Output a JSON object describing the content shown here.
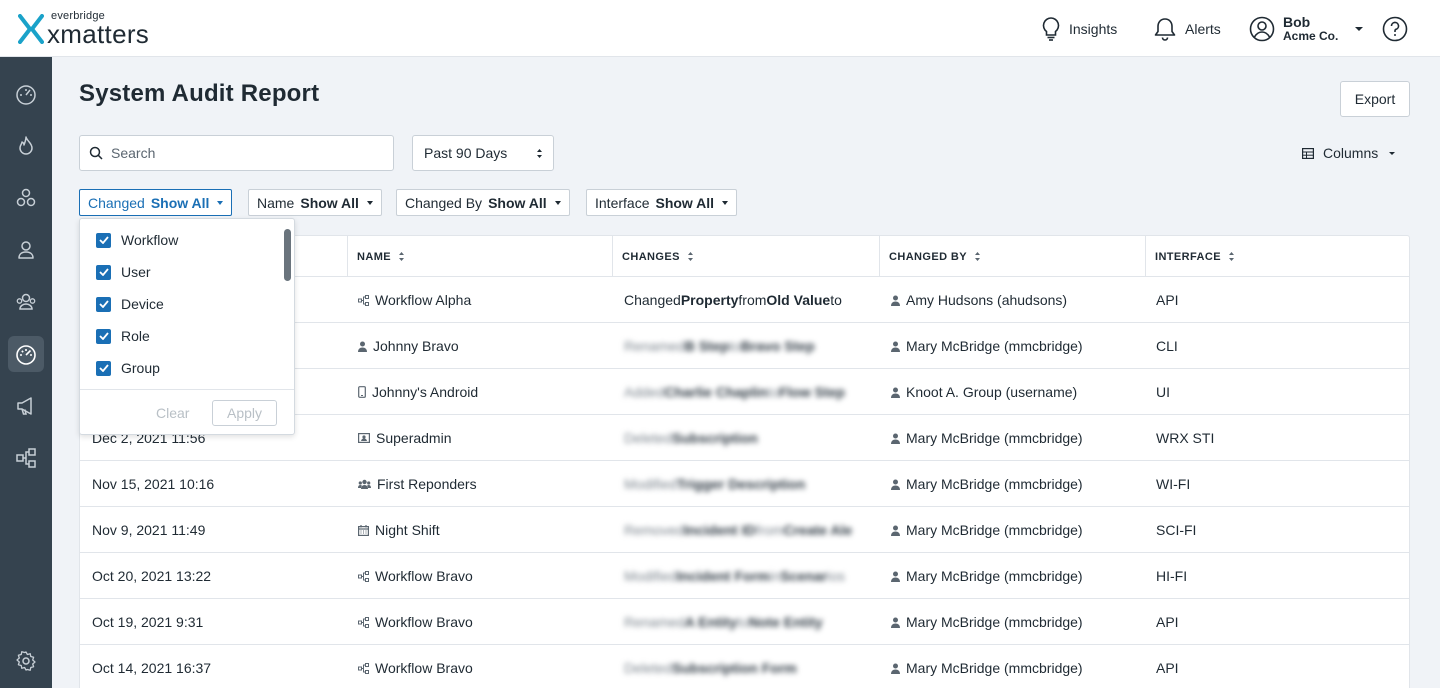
{
  "brand": {
    "small": "everbridge",
    "big": "xmatters"
  },
  "topbar": {
    "insights": "Insights",
    "alerts": "Alerts",
    "user_name": "Bob",
    "user_org": "Acme Co."
  },
  "page": {
    "title": "System Audit Report",
    "export_label": "Export",
    "search_placeholder": "Search",
    "range_value": "Past 90 Days",
    "columns_label": "Columns"
  },
  "filters": [
    {
      "label": "Changed",
      "value": "Show All"
    },
    {
      "label": "Name",
      "value": "Show All"
    },
    {
      "label": "Changed By",
      "value": "Show All"
    },
    {
      "label": "Interface",
      "value": "Show All"
    }
  ],
  "dropdown": {
    "items": [
      "Workflow",
      "User",
      "Device",
      "Role",
      "Group"
    ],
    "clear": "Clear",
    "apply": "Apply"
  },
  "table": {
    "headers": [
      "NAME",
      "CHANGES",
      "CHANGED BY",
      "INTERFACE"
    ],
    "rows": [
      {
        "date": "",
        "name": "Workflow Alpha",
        "name_icon": "workflow-icon",
        "change": {
          "a": "Changed ",
          "b": "Property",
          "c": " from ",
          "d": "Old Value",
          "e": " to"
        },
        "by": "Amy Hudsons (ahudsons)",
        "interface": "API"
      },
      {
        "date": "",
        "name": "Johnny Bravo",
        "name_icon": "user-icon",
        "change": {
          "a": "Renamed ",
          "b": "B Step",
          "c": " to ",
          "d": "Bravo Step",
          "e": ""
        },
        "by": "Mary McBridge (mmcbridge)",
        "interface": "CLI"
      },
      {
        "date": "",
        "name": "Johnny's Android",
        "name_icon": "mobile-icon",
        "change": {
          "a": "Added ",
          "b": "Charlie Chaplin",
          "c": " to ",
          "d": "Flow Step",
          "e": ""
        },
        "by": "Knoot A. Group (username)",
        "interface": "UI"
      },
      {
        "date": "Dec 2, 2021 11:56",
        "name": "Superadmin",
        "name_icon": "role-icon",
        "change": {
          "a": "Deleted ",
          "b": "Subscription",
          "c": "",
          "d": "",
          "e": ""
        },
        "by": "Mary McBridge (mmcbridge)",
        "interface": "WRX STI"
      },
      {
        "date": "Nov 15, 2021 10:16",
        "name": "First Reponders",
        "name_icon": "group-icon",
        "change": {
          "a": "Modified ",
          "b": "Trigger Description",
          "c": "",
          "d": "",
          "e": ""
        },
        "by": "Mary McBridge (mmcbridge)",
        "interface": "WI-FI"
      },
      {
        "date": "Nov 9, 2021 11:49",
        "name": "Night Shift",
        "name_icon": "calendar-icon",
        "change": {
          "a": "Removed ",
          "b": "Incident ID",
          "c": " from ",
          "d": "Create Ale",
          "e": ""
        },
        "by": "Mary McBridge (mmcbridge)",
        "interface": "SCI-FI"
      },
      {
        "date": "Oct 20, 2021 13:22",
        "name": "Workflow Bravo",
        "name_icon": "workflow-icon",
        "change": {
          "a": "Modified ",
          "b": "Incident Form",
          "c": " in ",
          "d": "Scenar",
          "e": "ios"
        },
        "by": "Mary McBridge (mmcbridge)",
        "interface": "HI-FI"
      },
      {
        "date": "Oct 19, 2021 9:31",
        "name": "Workflow Bravo",
        "name_icon": "workflow-icon",
        "change": {
          "a": "Renamed ",
          "b": "A Entity",
          "c": " to ",
          "d": "Note Entity",
          "e": ""
        },
        "by": "Mary McBridge (mmcbridge)",
        "interface": "API"
      },
      {
        "date": "Oct 14, 2021 16:37",
        "name": "Workflow Bravo",
        "name_icon": "workflow-icon",
        "change": {
          "a": "Deleted ",
          "b": "Subscription Form",
          "c": "",
          "d": "",
          "e": ""
        },
        "by": "Mary McBridge (mmcbridge)",
        "interface": "API"
      }
    ]
  },
  "colors": {
    "accent": "#1a6fb5",
    "sidebar": "#35434f",
    "brand": "#1aa2c9"
  }
}
